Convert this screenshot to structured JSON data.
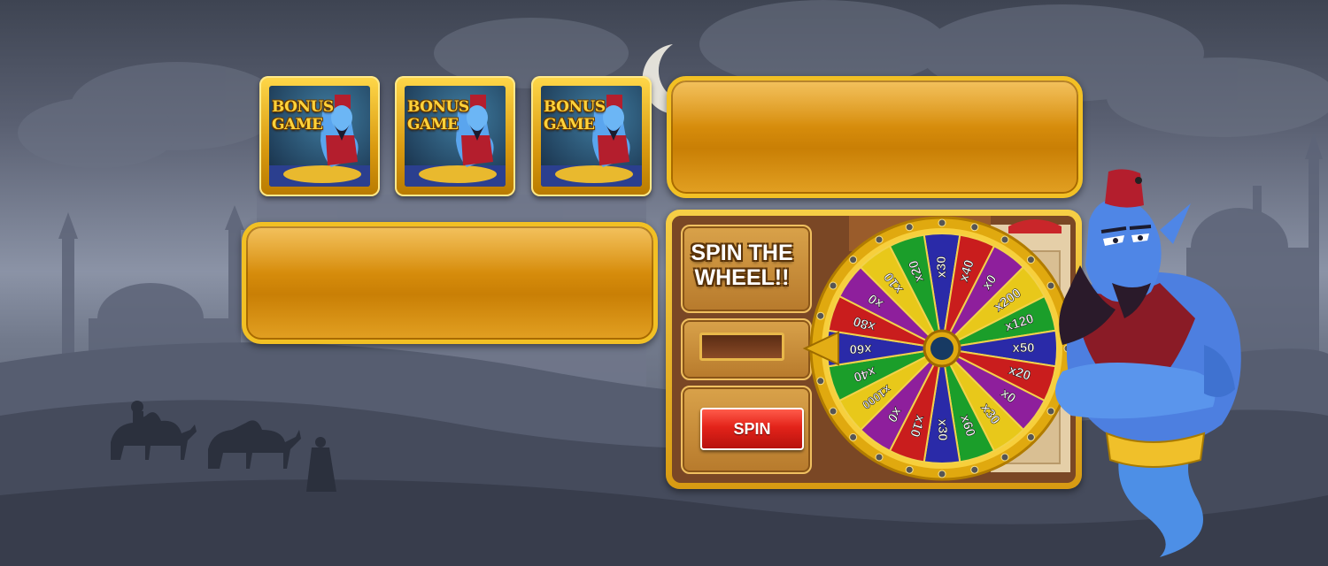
{
  "bonus_tiles": [
    {
      "title": "BONUS GAME"
    },
    {
      "title": "BONUS GAME"
    },
    {
      "title": "BONUS GAME"
    }
  ],
  "wheel_panel": {
    "title": "SPIN THE WHEEL!!",
    "win_value": "",
    "spin_label": "SPIN"
  },
  "wheel": {
    "segments": [
      {
        "label": "x30",
        "color": "#2a2aa8"
      },
      {
        "label": "x40",
        "color": "#c91d1d"
      },
      {
        "label": "x0",
        "color": "#8e1f9c"
      },
      {
        "label": "x200",
        "color": "#e8c81a"
      },
      {
        "label": "x120",
        "color": "#1b9e2a"
      },
      {
        "label": "x50",
        "color": "#2a2aa8"
      },
      {
        "label": "x20",
        "color": "#c91d1d"
      },
      {
        "label": "x0",
        "color": "#8e1f9c"
      },
      {
        "label": "x30",
        "color": "#e8c81a"
      },
      {
        "label": "x60",
        "color": "#1b9e2a"
      },
      {
        "label": "x30",
        "color": "#2a2aa8"
      },
      {
        "label": "x10",
        "color": "#c91d1d"
      },
      {
        "label": "x0",
        "color": "#8e1f9c"
      },
      {
        "label": "x1000",
        "color": "#e8c81a"
      },
      {
        "label": "x40",
        "color": "#1b9e2a"
      },
      {
        "label": "x60",
        "color": "#2a2aa8"
      },
      {
        "label": "x80",
        "color": "#c91d1d"
      },
      {
        "label": "x0",
        "color": "#8e1f9c"
      },
      {
        "label": "x10",
        "color": "#e8c81a"
      },
      {
        "label": "x20",
        "color": "#1b9e2a"
      }
    ]
  },
  "colors": {
    "gold": "#f2c024",
    "panel_orange": "#d78d0c",
    "spin_red": "#e3231a",
    "sky_top": "#3e4452",
    "genie_blue": "#4d7fe0"
  },
  "icons": [
    "bonus-game-icon",
    "genie-character",
    "wheel-pointer-icon"
  ]
}
